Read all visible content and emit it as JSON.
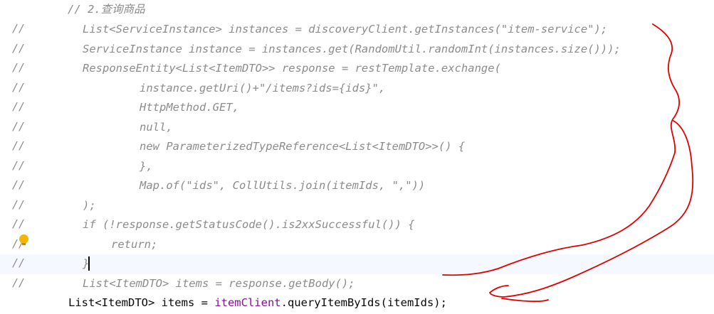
{
  "editor": {
    "lines": [
      {
        "marker": "",
        "text": "// 2.查询商品",
        "kind": "comment"
      },
      {
        "marker": "//",
        "text": "List<ServiceInstance> instances = discoveryClient.getInstances(\"item-service\");",
        "kind": "comment"
      },
      {
        "marker": "//",
        "text": "ServiceInstance instance = instances.get(RandomUtil.randomInt(instances.size()));",
        "kind": "comment"
      },
      {
        "marker": "//",
        "text": "ResponseEntity<List<ItemDTO>> response = restTemplate.exchange(",
        "kind": "comment"
      },
      {
        "marker": "//",
        "text": "instance.getUri()+\"/items?ids={ids}\",",
        "kind": "comment"
      },
      {
        "marker": "//",
        "text": "HttpMethod.GET,",
        "kind": "comment"
      },
      {
        "marker": "//",
        "text": "null,",
        "kind": "comment"
      },
      {
        "marker": "//",
        "text": "new ParameterizedTypeReference<List<ItemDTO>>() {",
        "kind": "comment"
      },
      {
        "marker": "//",
        "text": "},",
        "kind": "comment"
      },
      {
        "marker": "//",
        "text": "Map.of(\"ids\", CollUtils.join(itemIds, \",\"))",
        "kind": "comment"
      },
      {
        "marker": "//",
        "text": ");",
        "kind": "comment"
      },
      {
        "marker": "//",
        "text": "if (!response.getStatusCode().is2xxSuccessful()) {",
        "kind": "comment"
      },
      {
        "marker": "//",
        "text": "return;",
        "kind": "comment"
      },
      {
        "marker": "//",
        "text": "}",
        "kind": "comment"
      },
      {
        "marker": "//",
        "text": "List<ItemDTO> items = response.getBody();",
        "kind": "comment"
      },
      {
        "marker": "",
        "text": "List<ItemDTO> items = itemClient.queryItemByIds(itemIds);",
        "kind": "active"
      }
    ],
    "active_prefix": "List<ItemDTO> items = ",
    "active_field": "itemClient",
    "active_suffix": ".queryItemByIds(itemIds);"
  },
  "colors": {
    "comment": "#8c8c8c",
    "code": "#080808",
    "field": "#871094",
    "current_line": "#f5f8fe",
    "annotation": "#e00000",
    "bulb": "#f4b400"
  },
  "icons": {
    "intention": "lightbulb-icon"
  }
}
